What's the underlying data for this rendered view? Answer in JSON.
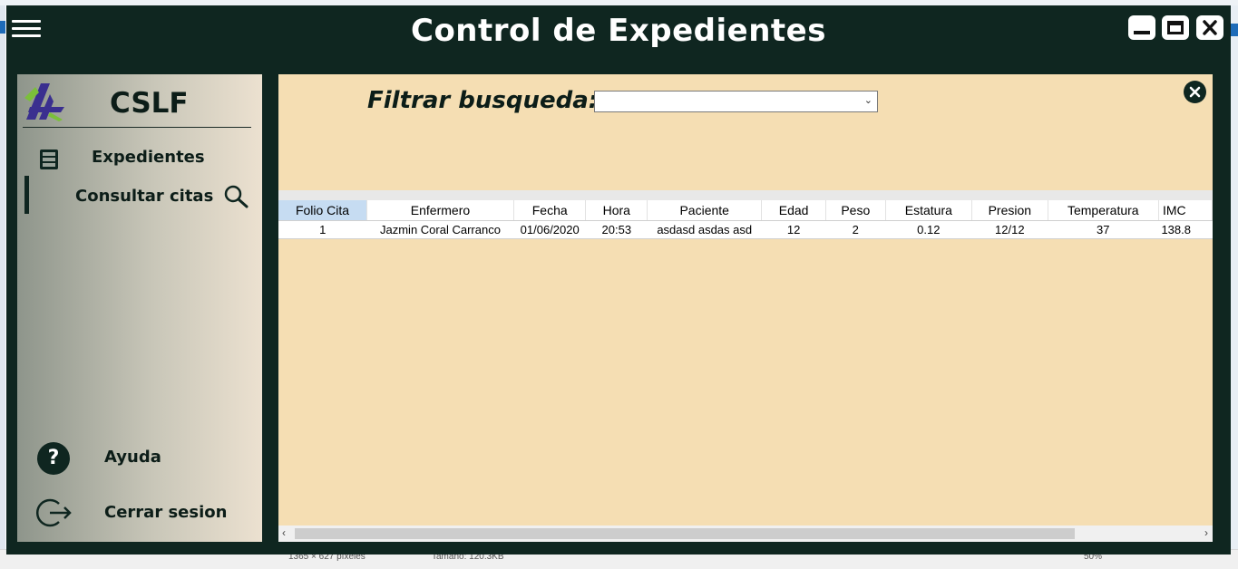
{
  "window": {
    "title": "Control de Expedientes",
    "buttons": [
      "minimize",
      "maximize",
      "close"
    ]
  },
  "sidebar": {
    "brand": "CSLF",
    "items": [
      {
        "label": "Expedientes",
        "icon": "file-cabinet-icon"
      },
      {
        "label": "Consultar citas",
        "icon": "search-icon",
        "active": true
      },
      {
        "label": "Ayuda",
        "icon": "help-icon"
      },
      {
        "label": "Cerrar sesion",
        "icon": "logout-icon"
      }
    ]
  },
  "filter": {
    "label": "Filtrar busqueda:",
    "selected": ""
  },
  "grid": {
    "columns": [
      "Folio Cita",
      "Enfermero",
      "Fecha",
      "Hora",
      "Paciente",
      "Edad",
      "Peso",
      "Estatura",
      "Presion",
      "Temperatura",
      "IMC"
    ],
    "rows": [
      [
        "1",
        "Jazmin Coral Carranco",
        "01/06/2020",
        "20:53",
        "asdasd asdas asd",
        "12",
        "2",
        "0.12",
        "12/12",
        "37",
        "138.8"
      ]
    ]
  },
  "host_status": {
    "dimensions": "1365 × 627 píxeles",
    "size": "Tamaño: 120.3KB",
    "zoom": "50%"
  },
  "colors": {
    "titlebar": "#0f2620",
    "content_bg": "#f5deb3",
    "selected_header": "#c6dcf2"
  }
}
